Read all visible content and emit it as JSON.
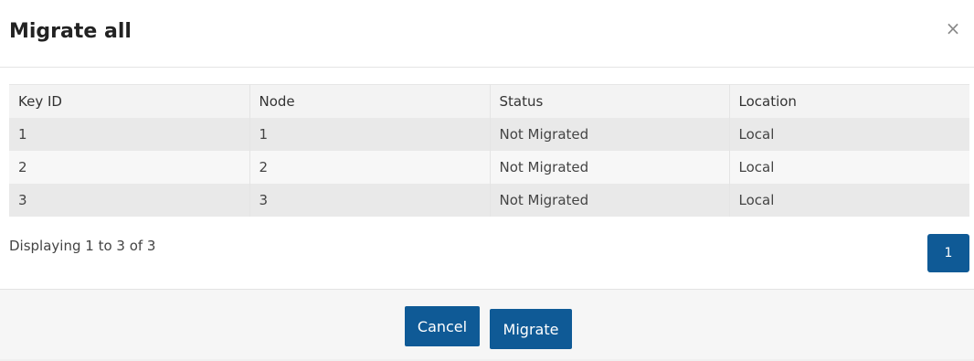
{
  "dialog": {
    "title": "Migrate all",
    "close_label": "×"
  },
  "table": {
    "headers": [
      "Key ID",
      "Node",
      "Status",
      "Location"
    ],
    "rows": [
      [
        "1",
        "1",
        "Not Migrated",
        "Local"
      ],
      [
        "2",
        "2",
        "Not Migrated",
        "Local"
      ],
      [
        "3",
        "3",
        "Not Migrated",
        "Local"
      ]
    ]
  },
  "pagination": {
    "info": "Displaying 1 to 3 of 3",
    "current_page": "1"
  },
  "footer": {
    "cancel_label": "Cancel",
    "migrate_label": "Migrate"
  },
  "colors": {
    "primary": "#0f5a96",
    "row_odd": "#e9e9e9",
    "row_even": "#f7f7f7"
  }
}
